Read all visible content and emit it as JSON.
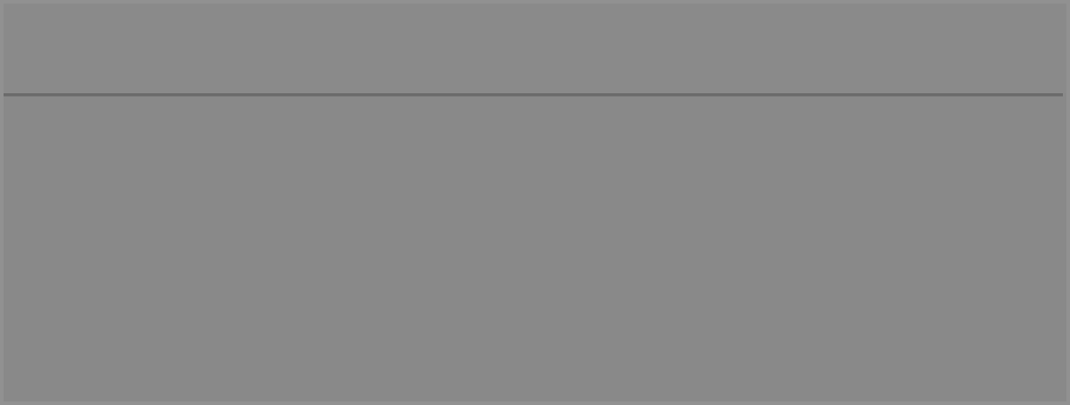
{
  "window": {
    "title": ""
  },
  "colors": {
    "background": "#898989",
    "border": "#919191",
    "divider": "#6b6b6b"
  }
}
